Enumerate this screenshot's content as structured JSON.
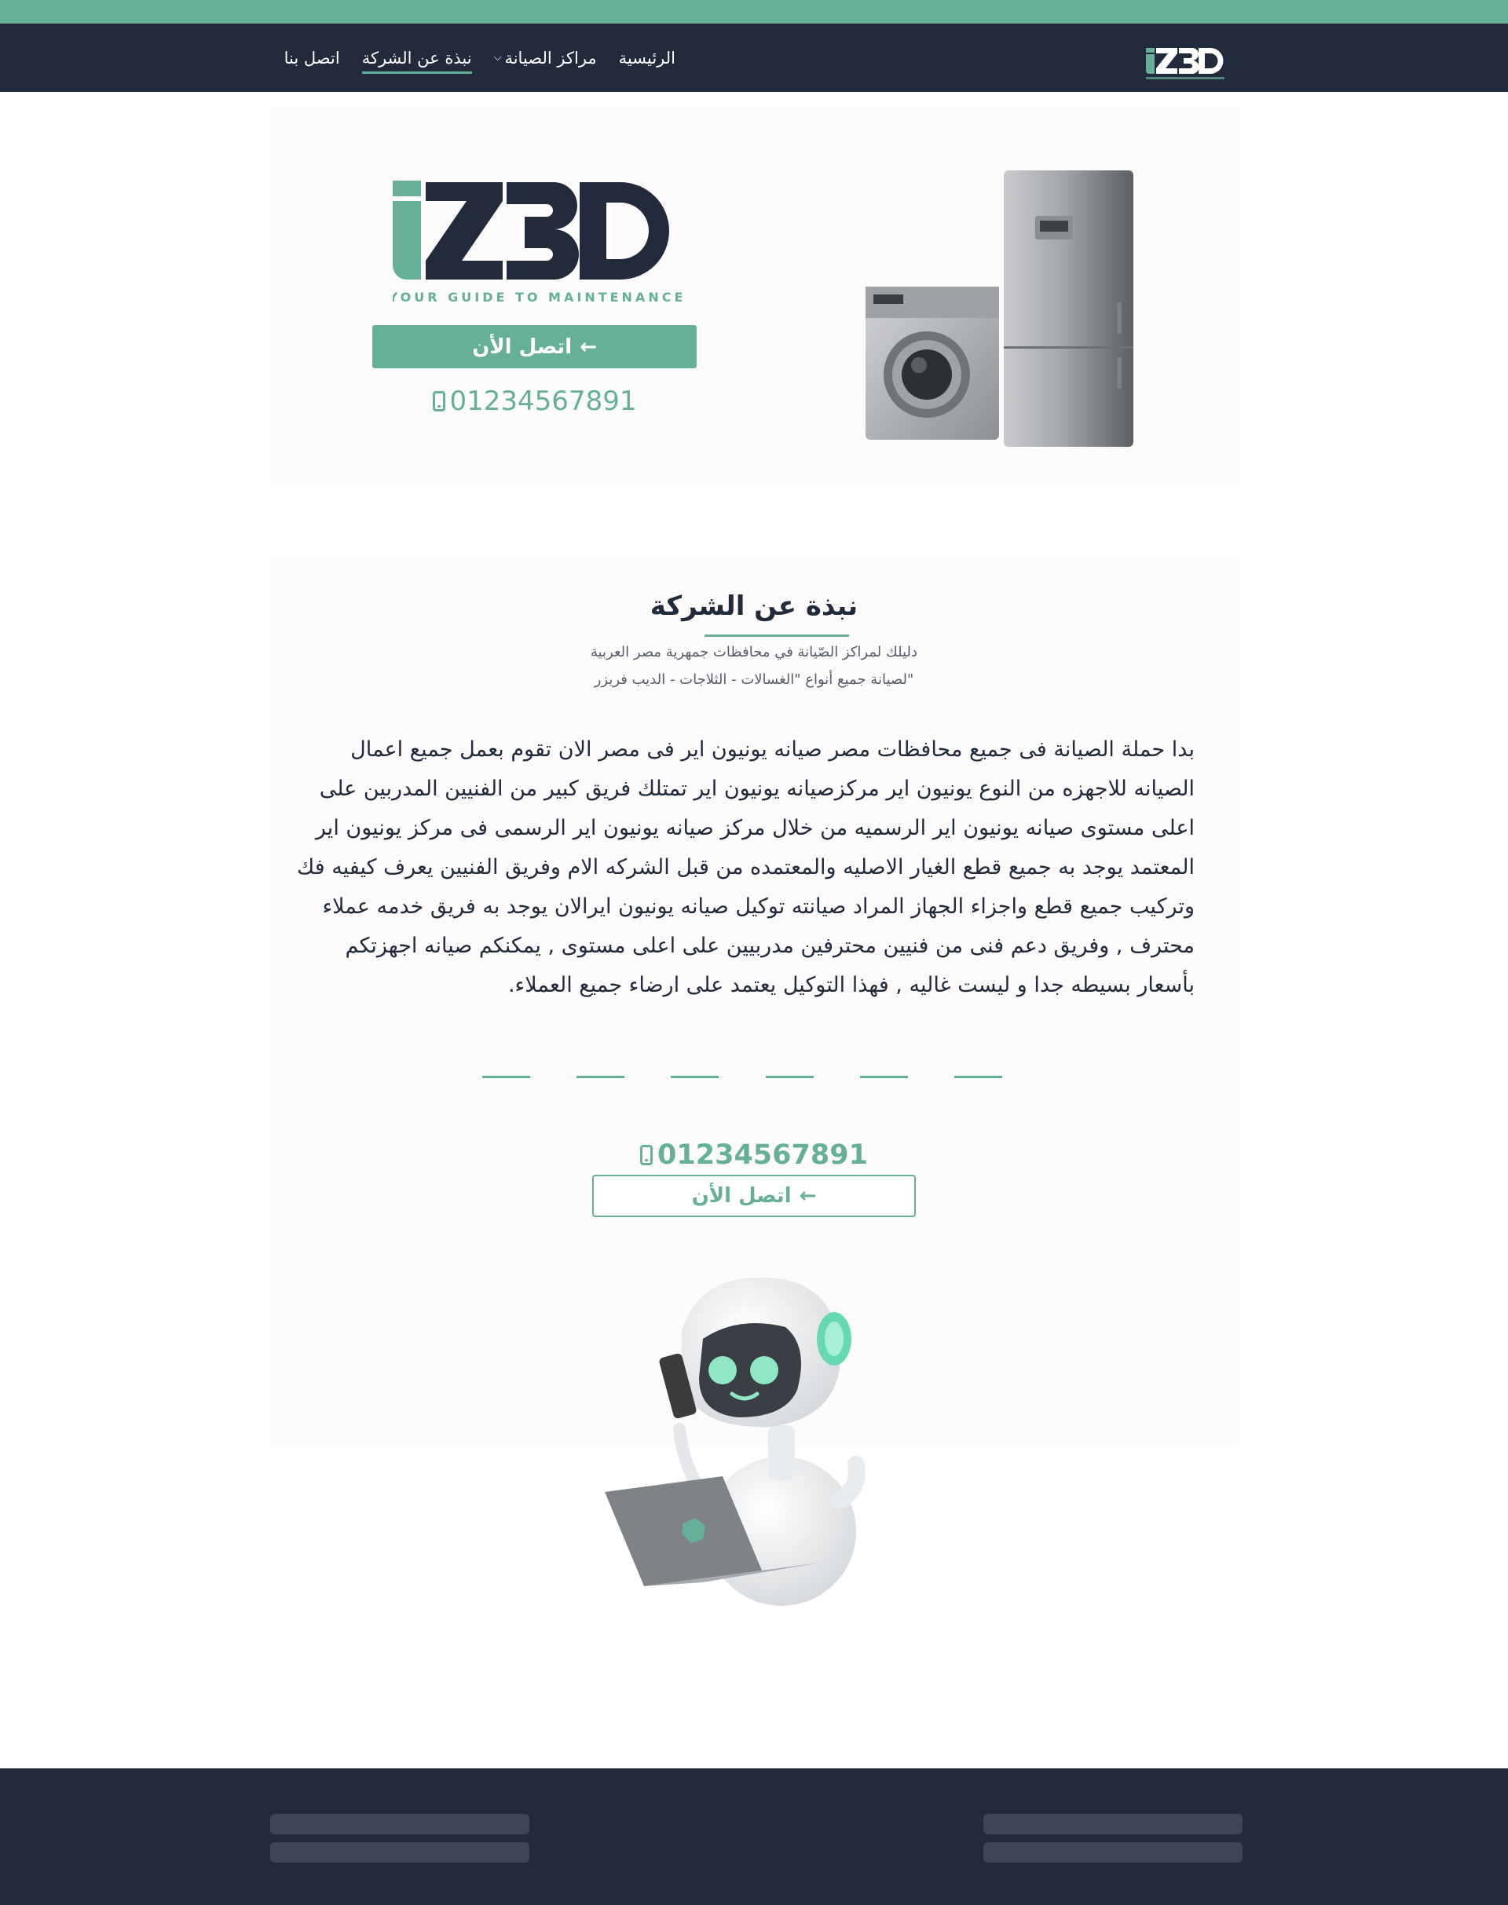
{
  "colors": {
    "accent": "#66af99",
    "dark": "#222b3b",
    "panel": "#fdfbfc"
  },
  "brand": {
    "logo_text": "iZ3D",
    "tagline": "YOUR GUIDE TO MAINTENANCE"
  },
  "nav": {
    "items": [
      {
        "label": "الرئيسية",
        "active": false
      },
      {
        "label": "مراكز الصيانة",
        "active": false,
        "has_dropdown": true
      },
      {
        "label": "نبذة عن الشركة",
        "active": true
      },
      {
        "label": "اتصل بنا",
        "active": false
      }
    ]
  },
  "hero": {
    "cta_label": "اتصل الأن",
    "phone": "01234567891"
  },
  "about": {
    "title": "نبذة عن الشركة",
    "subtitle_1": "دليلك لمراكز الصّيانة في محافظات جمهرية مصر العربية",
    "subtitle_2": "\"لصيانة جميع أنواع \"الغسالات - الثلاجات - الديب فريزر",
    "body": "بدا حملة الصيانة فى جميع محافظات مصر صيانه يونيون اير فى مصر الان تقوم بعمل جميع اعمال الصيانه للاجهزه من النوع يونيون اير مركزصيانه يونيون اير تمتلك فريق كبير من الفنيين المدربين على اعلى مستوى صيانه يونيون اير الرسميه من خلال مركز صيانه يونيون اير الرسمى فى مركز يونيون اير المعتمد يوجد به جميع قطع الغيار الاصليه والمعتمده من قبل الشركه الام وفريق الفنيين يعرف كيفيه فك وتركيب جميع قطع واجزاء الجهاز المراد صيانته توكيل صيانه يونيون ايرالان يوجد به فريق خدمه عملاء محترف , وفريق دعم فنى من فنيين محترفين مدربيين على اعلى مستوى , يمكنكم صيانه اجهزتكم بأسعار بسيطه جدا و ليست غاليه , فهذا التوكيل يعتمد على ارضاء جميع العملاء.",
    "phone": "01234567891",
    "cta_label": "اتصل الأن"
  },
  "icons": {
    "phone": "mobile-phone-icon",
    "arrow": "arrow-left-icon",
    "caret": "chevron-down-icon"
  }
}
